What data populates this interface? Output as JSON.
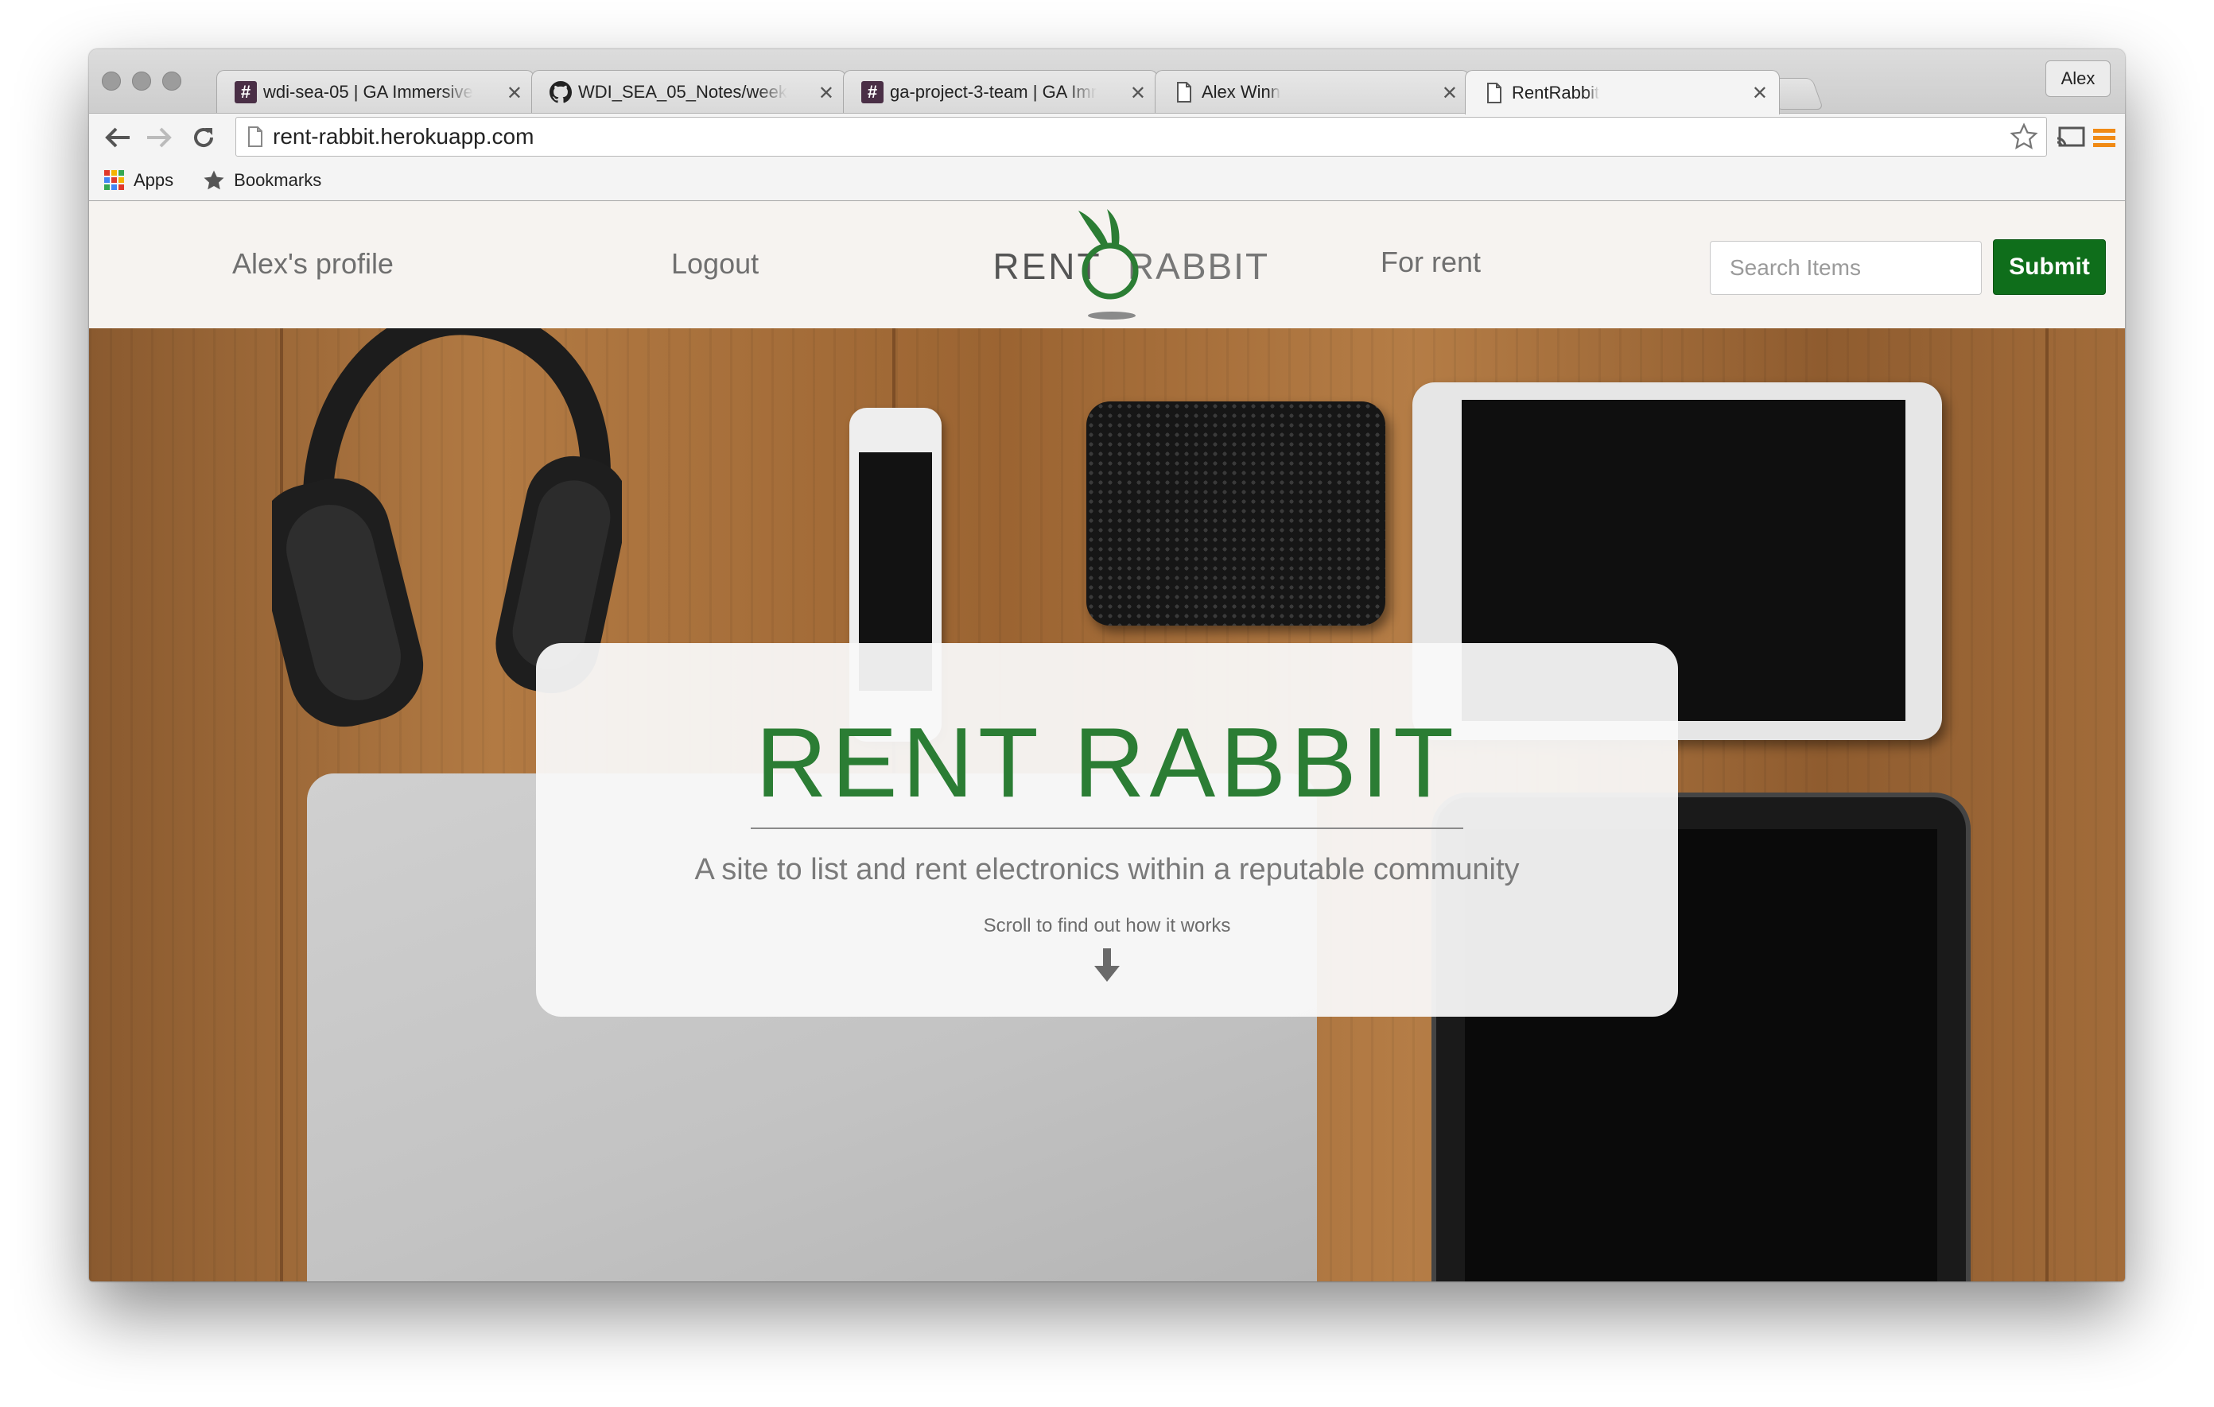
{
  "browser": {
    "tabs": [
      {
        "title": "wdi-sea-05 | GA Immersive",
        "icon": "slack-icon"
      },
      {
        "title": "WDI_SEA_05_Notes/week",
        "icon": "github-icon"
      },
      {
        "title": "ga-project-3-team | GA Imr",
        "icon": "slack-icon"
      },
      {
        "title": "Alex Winn",
        "icon": "page-icon"
      },
      {
        "title": "RentRabbit",
        "icon": "page-icon",
        "active": true
      }
    ],
    "profile_name": "Alex",
    "url": "rent-rabbit.herokuapp.com",
    "bookmarks": {
      "apps_label": "Apps",
      "bookmarks_label": "Bookmarks"
    }
  },
  "nav": {
    "profile_link": "Alex's profile",
    "logout_link": "Logout",
    "logo": {
      "word1": "RENT",
      "word2": "RABBIT"
    },
    "for_rent_link": "For rent",
    "search_placeholder": "Search Items",
    "submit_label": "Submit"
  },
  "hero": {
    "title": "RENT RABBIT",
    "subtitle": "A site to list and rent electronics within a reputable community",
    "scroll_hint": "Scroll to find out how it works"
  },
  "colors": {
    "brand_green": "#2b7d34",
    "submit_green": "#0f6e1b",
    "navbar_bg": "#f6f3f0"
  }
}
